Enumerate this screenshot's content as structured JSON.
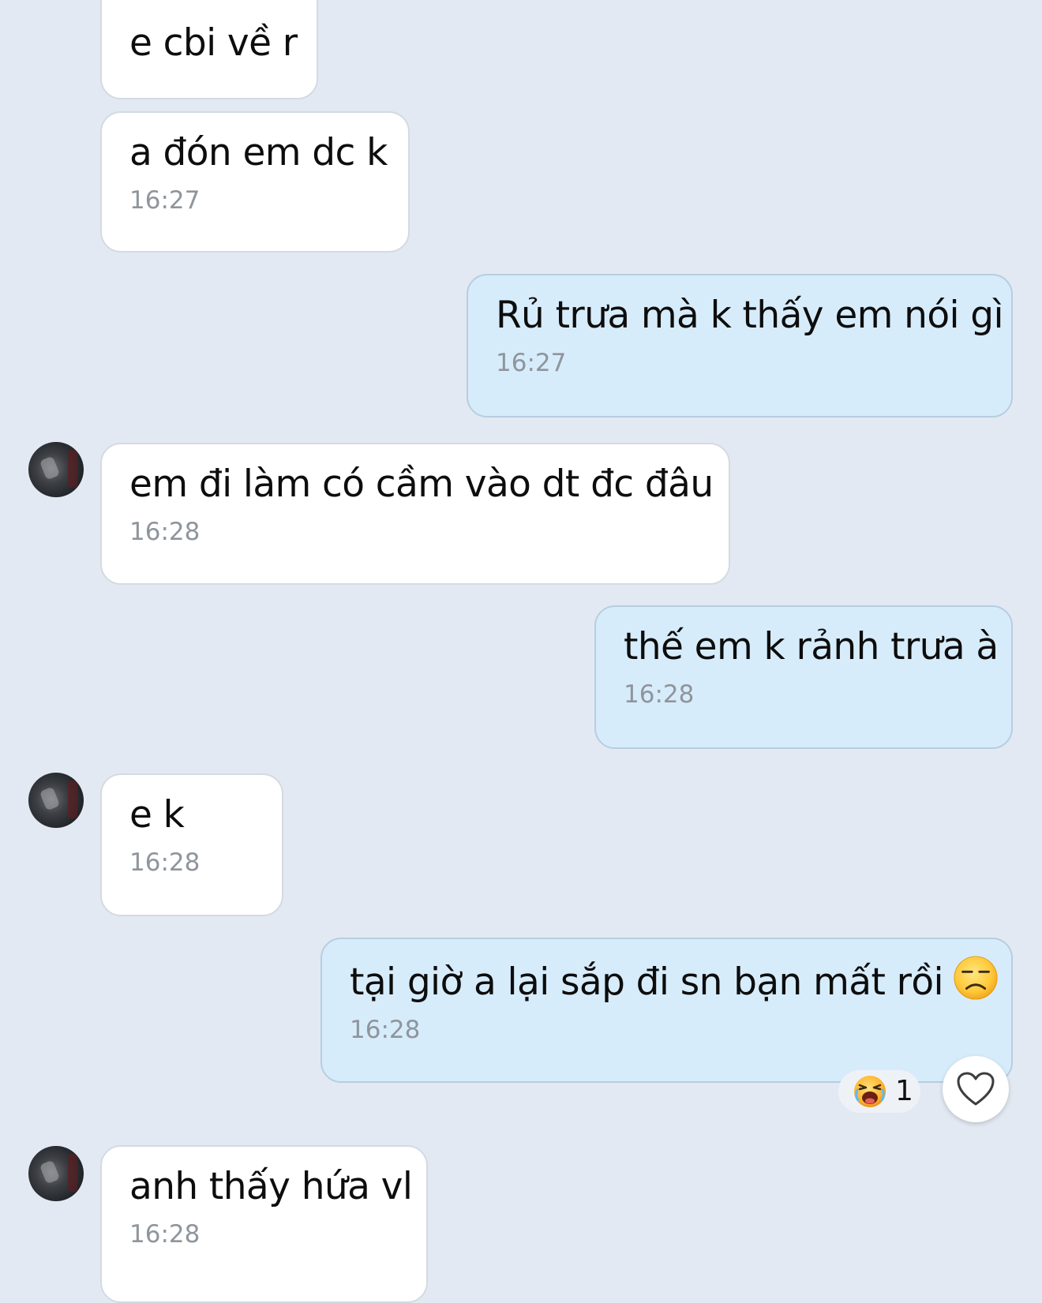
{
  "messages": [
    {
      "side": "in",
      "text": "e cbi về r",
      "time": ""
    },
    {
      "side": "in",
      "text": "a đón em dc k",
      "time": "16:27"
    },
    {
      "side": "out",
      "text": "Rủ trưa mà k thấy em nói gì",
      "time": "16:27"
    },
    {
      "side": "in",
      "text": "em đi làm có cầm vào dt đc đâu",
      "time": "16:28"
    },
    {
      "side": "out",
      "text": "thế em k rảnh trưa à",
      "time": "16:28"
    },
    {
      "side": "in",
      "text": "e k",
      "time": "16:28"
    },
    {
      "side": "out",
      "text": "tại giờ a lại sắp đi sn bạn mất rồi",
      "emoji": "frowning-emoji",
      "time": "16:28",
      "reaction": {
        "icon": "laughing-emoji",
        "count": "1"
      }
    },
    {
      "side": "in",
      "text": "anh thấy hứa vl",
      "time": "16:28"
    }
  ],
  "colors": {
    "background": "#e2e9f2",
    "incoming_bubble": "#ffffff",
    "outgoing_bubble": "#d7ecfb",
    "timestamp": "#8f959c"
  },
  "icons": {
    "heart": "heart-outline-icon",
    "avatar": "contact-avatar"
  }
}
